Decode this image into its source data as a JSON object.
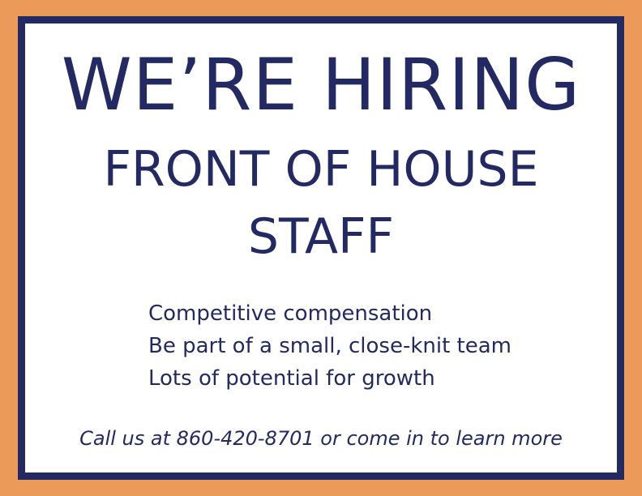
{
  "poster": {
    "headline": "WE’RE HIRING",
    "position_line1": "FRONT OF HOUSE",
    "position_line2": "STAFF",
    "benefits": [
      "Competitive compensation",
      "Be part of a small, close-knit team",
      "Lots of potential for growth"
    ],
    "call_to_action": "Call us at 860-420-8701 or come in to learn more"
  },
  "colors": {
    "background_orange": "#ec9a5a",
    "navy": "#232a63",
    "panel_white": "#ffffff"
  }
}
